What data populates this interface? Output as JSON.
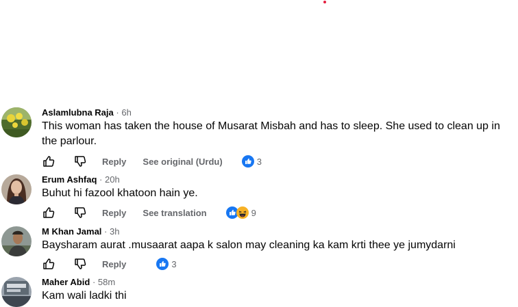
{
  "colors": {
    "like_blue": "#1877f2",
    "haha_yellow": "#f7b125",
    "secondary_text": "#65676b",
    "primary_text": "#050505",
    "notification_dot": "#e41e3f"
  },
  "icons": {
    "like": "thumbs-up-outline-icon",
    "dislike": "thumbs-down-outline-icon",
    "like_reaction": "like-reaction-icon",
    "haha_reaction": "haha-reaction-icon"
  },
  "comments": [
    {
      "author": "Aslamlubna Raja",
      "separator": "·",
      "time": "6h",
      "text": "This woman has taken the house of Musarat Misbah and has to sleep. She used to clean up in the parlour.",
      "reply_label": "Reply",
      "translation_label": "See original (Urdu)",
      "reaction_count": "3"
    },
    {
      "author": "Erum Ashfaq",
      "separator": "·",
      "time": "20h",
      "text": "Buhut hi fazool khatoon hain ye.",
      "reply_label": "Reply",
      "translation_label": "See translation",
      "reaction_count": "9"
    },
    {
      "author": "M Khan Jamal",
      "separator": "·",
      "time": "3h",
      "text": "Baysharam aurat .musaarat aapa k salon may cleaning ka kam krti thee ye jumydarni",
      "reply_label": "Reply",
      "reaction_count": "3"
    },
    {
      "author": "Maher Abid",
      "separator": "·",
      "time": "58m",
      "text": "Kam wali ladki thi"
    }
  ]
}
